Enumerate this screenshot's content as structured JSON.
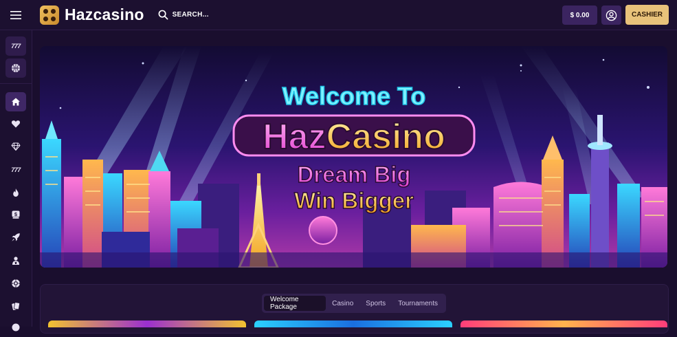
{
  "header": {
    "brand": "Hazcasino",
    "search_placeholder": "SEARCH...",
    "balance": "$ 0.00",
    "cashier_label": "CASHIER"
  },
  "sidebar": {
    "top_items": [
      {
        "name": "slots",
        "text": "777"
      },
      {
        "name": "sports",
        "icon": "basketball-icon"
      }
    ],
    "nav_items": [
      {
        "name": "home",
        "icon": "home-icon",
        "active": true
      },
      {
        "name": "favorites",
        "icon": "heart-icon"
      },
      {
        "name": "vip",
        "icon": "diamond-icon"
      },
      {
        "name": "slots",
        "text": "777"
      },
      {
        "name": "hot",
        "icon": "flame-icon"
      },
      {
        "name": "bonus",
        "icon": "dollar-badge-icon"
      },
      {
        "name": "new",
        "icon": "rocket-icon"
      },
      {
        "name": "live-dealer",
        "icon": "dealer-icon"
      },
      {
        "name": "table-games",
        "icon": "chip-icon"
      },
      {
        "name": "blackjack",
        "icon": "cards-icon"
      }
    ]
  },
  "banner": {
    "line1": "Welcome To",
    "line2_part1": "Haz",
    "line2_part2": "Casino",
    "line3": "Dream Big",
    "line4": "Win Bigger"
  },
  "promo_tabs": [
    {
      "label": "Welcome Package",
      "active": true
    },
    {
      "label": "Casino",
      "active": false
    },
    {
      "label": "Sports",
      "active": false
    },
    {
      "label": "Tournaments",
      "active": false
    }
  ],
  "colors": {
    "background": "#1a0e2e",
    "panel": "#1c1030",
    "accent_gold": "#e8c27a",
    "button_purple": "#3b2460"
  }
}
